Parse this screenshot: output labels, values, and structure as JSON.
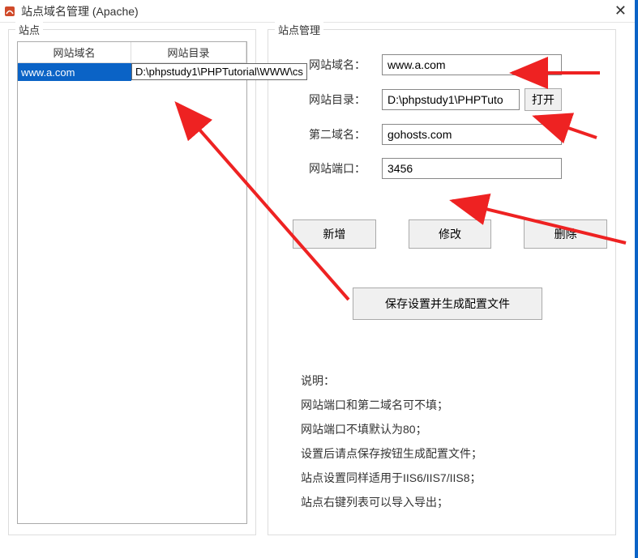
{
  "window": {
    "title": "站点域名管理 (Apache)",
    "close": "✕"
  },
  "left": {
    "legend": "站点",
    "headers": {
      "domain": "网站域名",
      "dir": "网站目录"
    },
    "rows": [
      {
        "domain": "www.a.com",
        "dir": "",
        "tooltip": "D:\\phpstudy1\\PHPTutorial\\WWW\\cs"
      }
    ]
  },
  "right": {
    "legend": "站点管理",
    "labels": {
      "domain": "网站域名：",
      "dir": "网站目录：",
      "second": "第二域名：",
      "port": "网站端口："
    },
    "values": {
      "domain": "www.a.com",
      "dir": "D:\\phpstudy1\\PHPTuto",
      "second": "gohosts.com",
      "port": "3456"
    },
    "buttons": {
      "open": "打开",
      "add": "新增",
      "edit": "修改",
      "delete": "删除",
      "save": "保存设置并生成配置文件"
    },
    "notes": {
      "title": "说明：",
      "l1": "网站端口和第二域名可不填；",
      "l2": "网站端口不填默认为80；",
      "l3": "设置后请点保存按钮生成配置文件；",
      "l4": "站点设置同样适用于IIS6/IIS7/IIS8；",
      "l5": "站点右键列表可以导入导出；"
    }
  }
}
